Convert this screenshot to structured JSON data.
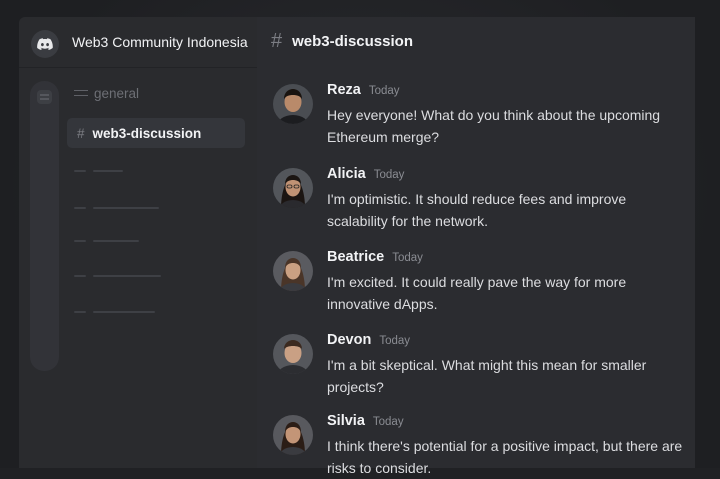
{
  "server": {
    "name": "Web3 Community Indonesia",
    "icon": "discord-icon"
  },
  "channels": [
    {
      "name": "general",
      "icon": "text-channel-icon",
      "active": false
    },
    {
      "name": "web3-discussion",
      "icon": "hash-icon",
      "active": true
    }
  ],
  "chat": {
    "channel_hash": "#",
    "channel_title": "web3-discussion",
    "messages": [
      {
        "author": "Reza",
        "timestamp": "Today",
        "text": "Hey everyone! What do you think about the upcoming Ethereum merge?"
      },
      {
        "author": "Alicia",
        "timestamp": "Today",
        "text": "I'm optimistic. It should reduce fees and improve scalability for the network."
      },
      {
        "author": "Beatrice",
        "timestamp": "Today",
        "text": "I'm excited. It could really pave the way for more innovative dApps."
      },
      {
        "author": "Devon",
        "timestamp": "Today",
        "text": "I'm a bit skeptical. What might this mean for smaller projects?"
      },
      {
        "author": "Silvia",
        "timestamp": "Today",
        "text": "I think there's potential for a positive impact, but there are risks to consider."
      }
    ]
  },
  "colors": {
    "background": "#1e1f22",
    "sidebar": "#2a2b2e",
    "chat": "#2b2c30",
    "active_channel": "#34363b",
    "text_primary": "#f2f3f5"
  }
}
